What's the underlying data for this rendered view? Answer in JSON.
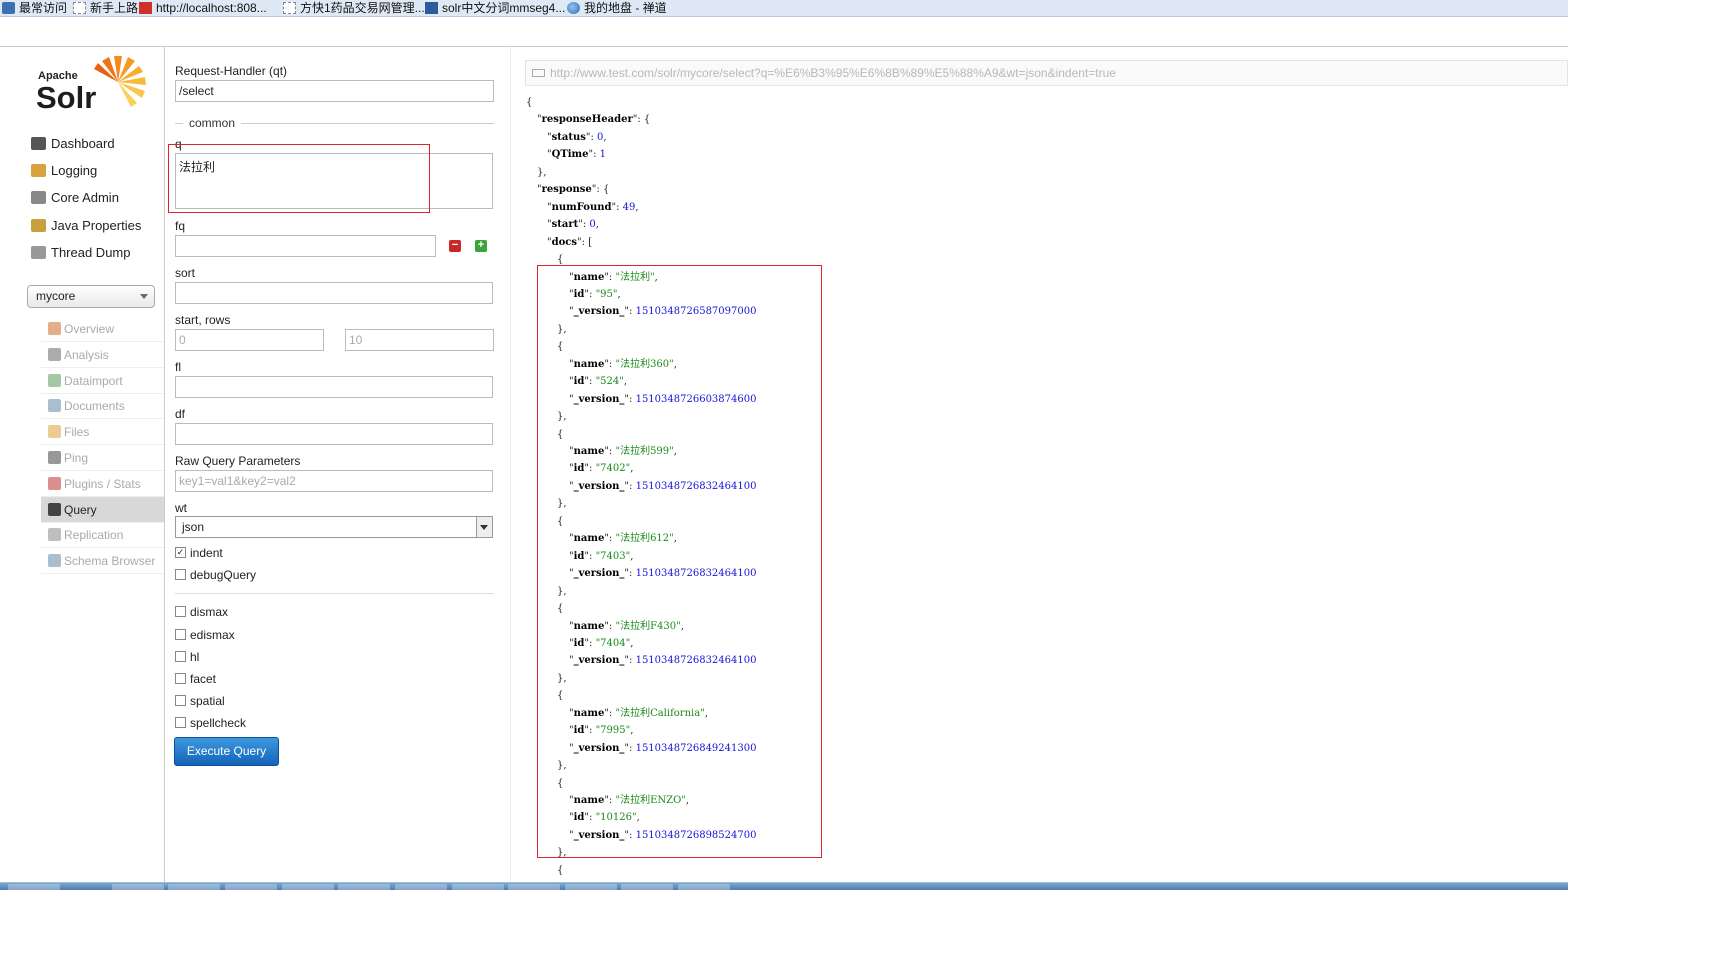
{
  "bookmarks": [
    {
      "label": "最常访问",
      "icon": "bookmark-icon"
    },
    {
      "label": "新手上路",
      "icon": "page-icon"
    },
    {
      "label": "http://localhost:808...",
      "icon": "bookmark-icon"
    },
    {
      "label": "方快1药品交易网管理...",
      "icon": "page-icon"
    },
    {
      "label": "solr中文分词mmseg4...",
      "icon": "note-icon"
    },
    {
      "label": "我的地盘 - 禅道",
      "icon": "globe-icon"
    }
  ],
  "logo": {
    "small": "Apache",
    "big": "Solr"
  },
  "nav": [
    {
      "label": "Dashboard",
      "icon": "dashboard-icon",
      "color": "#555555"
    },
    {
      "label": "Logging",
      "icon": "logging-icon",
      "color": "#d9a23c"
    },
    {
      "label": "Core Admin",
      "icon": "core-admin-icon",
      "color": "#888888"
    },
    {
      "label": "Java Properties",
      "icon": "java-icon",
      "color": "#c8a040"
    },
    {
      "label": "Thread Dump",
      "icon": "thread-icon",
      "color": "#999999"
    }
  ],
  "core_select": {
    "value": "mycore"
  },
  "core_menu": [
    {
      "label": "Overview",
      "icon": "home-icon",
      "color": "#d06a2c"
    },
    {
      "label": "Analysis",
      "icon": "funnel-icon",
      "color": "#666666"
    },
    {
      "label": "Dataimport",
      "icon": "import-icon",
      "color": "#5a9a5a"
    },
    {
      "label": "Documents",
      "icon": "documents-icon",
      "color": "#6688aa"
    },
    {
      "label": "Files",
      "icon": "files-icon",
      "color": "#d9a23c"
    },
    {
      "label": "Ping",
      "icon": "ping-icon",
      "color": "#444444"
    },
    {
      "label": "Plugins / Stats",
      "icon": "plugins-icon",
      "color": "#c03030"
    },
    {
      "label": "Query",
      "icon": "search-icon",
      "color": "#444444"
    },
    {
      "label": "Replication",
      "icon": "replication-icon",
      "color": "#888888"
    },
    {
      "label": "Schema Browser",
      "icon": "schema-icon",
      "color": "#6688aa"
    }
  ],
  "form": {
    "request_handler_label": "Request-Handler (qt)",
    "request_handler_value": "/select",
    "common_label": "common",
    "q_label": "q",
    "q_value": "法拉利",
    "fq_label": "fq",
    "fq_value": "",
    "sort_label": "sort",
    "sort_value": "",
    "start_rows_label": "start, rows",
    "start_placeholder": "0",
    "rows_placeholder": "10",
    "fl_label": "fl",
    "df_label": "df",
    "raw_label": "Raw Query Parameters",
    "raw_placeholder": "key1=val1&key2=val2",
    "wt_label": "wt",
    "wt_value": "json",
    "checkboxes": [
      {
        "label": "indent",
        "checked": true
      },
      {
        "label": "debugQuery",
        "checked": false
      },
      {
        "label": "dismax",
        "checked": false
      },
      {
        "label": "edismax",
        "checked": false
      },
      {
        "label": "hl",
        "checked": false
      },
      {
        "label": "facet",
        "checked": false
      },
      {
        "label": "spatial",
        "checked": false
      },
      {
        "label": "spellcheck",
        "checked": false
      }
    ],
    "execute_label": "Execute Query"
  },
  "result_url": "http://www.test.com/solr/mycore/select?q=%E6%B3%95%E6%8B%89%E5%88%A9&wt=json&indent=true",
  "json_lines": [
    {
      "i": 0,
      "t": [
        [
          "p",
          "{"
        ]
      ]
    },
    {
      "i": 1,
      "t": [
        [
          "p",
          "\""
        ],
        [
          "k",
          "responseHeader"
        ],
        [
          "p",
          "\": {"
        ]
      ]
    },
    {
      "i": 2,
      "t": [
        [
          "p",
          "\""
        ],
        [
          "k",
          "status"
        ],
        [
          "p",
          "\": "
        ],
        [
          "n",
          "0"
        ],
        [
          "p",
          ","
        ]
      ]
    },
    {
      "i": 2,
      "t": [
        [
          "p",
          "\""
        ],
        [
          "k",
          "QTime"
        ],
        [
          "p",
          "\": "
        ],
        [
          "n",
          "1"
        ]
      ]
    },
    {
      "i": 1,
      "t": [
        [
          "p",
          "},"
        ]
      ]
    },
    {
      "i": 1,
      "t": [
        [
          "p",
          "\""
        ],
        [
          "k",
          "response"
        ],
        [
          "p",
          "\": {"
        ]
      ]
    },
    {
      "i": 2,
      "t": [
        [
          "p",
          "\""
        ],
        [
          "k",
          "numFound"
        ],
        [
          "p",
          "\": "
        ],
        [
          "n",
          "49"
        ],
        [
          "p",
          ","
        ]
      ]
    },
    {
      "i": 2,
      "t": [
        [
          "p",
          "\""
        ],
        [
          "k",
          "start"
        ],
        [
          "p",
          "\": "
        ],
        [
          "n",
          "0"
        ],
        [
          "p",
          ","
        ]
      ]
    },
    {
      "i": 2,
      "t": [
        [
          "p",
          "\""
        ],
        [
          "k",
          "docs"
        ],
        [
          "p",
          "\": ["
        ]
      ]
    },
    {
      "i": 3,
      "t": [
        [
          "p",
          "{"
        ]
      ]
    },
    {
      "i": 4,
      "t": [
        [
          "p",
          "\""
        ],
        [
          "k",
          "name"
        ],
        [
          "p",
          "\": "
        ],
        [
          "s",
          "\"法拉利\""
        ],
        [
          "p",
          ","
        ]
      ]
    },
    {
      "i": 4,
      "t": [
        [
          "p",
          "\""
        ],
        [
          "k",
          "id"
        ],
        [
          "p",
          "\": "
        ],
        [
          "s",
          "\"95\""
        ],
        [
          "p",
          ","
        ]
      ]
    },
    {
      "i": 4,
      "t": [
        [
          "p",
          "\""
        ],
        [
          "k",
          "_version_"
        ],
        [
          "p",
          "\": "
        ],
        [
          "n",
          "1510348726587097000"
        ]
      ]
    },
    {
      "i": 3,
      "t": [
        [
          "p",
          "},"
        ]
      ]
    },
    {
      "i": 3,
      "t": [
        [
          "p",
          "{"
        ]
      ]
    },
    {
      "i": 4,
      "t": [
        [
          "p",
          "\""
        ],
        [
          "k",
          "name"
        ],
        [
          "p",
          "\": "
        ],
        [
          "s",
          "\"法拉利360\""
        ],
        [
          "p",
          ","
        ]
      ]
    },
    {
      "i": 4,
      "t": [
        [
          "p",
          "\""
        ],
        [
          "k",
          "id"
        ],
        [
          "p",
          "\": "
        ],
        [
          "s",
          "\"524\""
        ],
        [
          "p",
          ","
        ]
      ]
    },
    {
      "i": 4,
      "t": [
        [
          "p",
          "\""
        ],
        [
          "k",
          "_version_"
        ],
        [
          "p",
          "\": "
        ],
        [
          "n",
          "1510348726603874600"
        ]
      ]
    },
    {
      "i": 3,
      "t": [
        [
          "p",
          "},"
        ]
      ]
    },
    {
      "i": 3,
      "t": [
        [
          "p",
          "{"
        ]
      ]
    },
    {
      "i": 4,
      "t": [
        [
          "p",
          "\""
        ],
        [
          "k",
          "name"
        ],
        [
          "p",
          "\": "
        ],
        [
          "s",
          "\"法拉利599\""
        ],
        [
          "p",
          ","
        ]
      ]
    },
    {
      "i": 4,
      "t": [
        [
          "p",
          "\""
        ],
        [
          "k",
          "id"
        ],
        [
          "p",
          "\": "
        ],
        [
          "s",
          "\"7402\""
        ],
        [
          "p",
          ","
        ]
      ]
    },
    {
      "i": 4,
      "t": [
        [
          "p",
          "\""
        ],
        [
          "k",
          "_version_"
        ],
        [
          "p",
          "\": "
        ],
        [
          "n",
          "1510348726832464100"
        ]
      ]
    },
    {
      "i": 3,
      "t": [
        [
          "p",
          "},"
        ]
      ]
    },
    {
      "i": 3,
      "t": [
        [
          "p",
          "{"
        ]
      ]
    },
    {
      "i": 4,
      "t": [
        [
          "p",
          "\""
        ],
        [
          "k",
          "name"
        ],
        [
          "p",
          "\": "
        ],
        [
          "s",
          "\"法拉利612\""
        ],
        [
          "p",
          ","
        ]
      ]
    },
    {
      "i": 4,
      "t": [
        [
          "p",
          "\""
        ],
        [
          "k",
          "id"
        ],
        [
          "p",
          "\": "
        ],
        [
          "s",
          "\"7403\""
        ],
        [
          "p",
          ","
        ]
      ]
    },
    {
      "i": 4,
      "t": [
        [
          "p",
          "\""
        ],
        [
          "k",
          "_version_"
        ],
        [
          "p",
          "\": "
        ],
        [
          "n",
          "1510348726832464100"
        ]
      ]
    },
    {
      "i": 3,
      "t": [
        [
          "p",
          "},"
        ]
      ]
    },
    {
      "i": 3,
      "t": [
        [
          "p",
          "{"
        ]
      ]
    },
    {
      "i": 4,
      "t": [
        [
          "p",
          "\""
        ],
        [
          "k",
          "name"
        ],
        [
          "p",
          "\": "
        ],
        [
          "s",
          "\"法拉利F430\""
        ],
        [
          "p",
          ","
        ]
      ]
    },
    {
      "i": 4,
      "t": [
        [
          "p",
          "\""
        ],
        [
          "k",
          "id"
        ],
        [
          "p",
          "\": "
        ],
        [
          "s",
          "\"7404\""
        ],
        [
          "p",
          ","
        ]
      ]
    },
    {
      "i": 4,
      "t": [
        [
          "p",
          "\""
        ],
        [
          "k",
          "_version_"
        ],
        [
          "p",
          "\": "
        ],
        [
          "n",
          "1510348726832464100"
        ]
      ]
    },
    {
      "i": 3,
      "t": [
        [
          "p",
          "},"
        ]
      ]
    },
    {
      "i": 3,
      "t": [
        [
          "p",
          "{"
        ]
      ]
    },
    {
      "i": 4,
      "t": [
        [
          "p",
          "\""
        ],
        [
          "k",
          "name"
        ],
        [
          "p",
          "\": "
        ],
        [
          "s",
          "\"法拉利California\""
        ],
        [
          "p",
          ","
        ]
      ]
    },
    {
      "i": 4,
      "t": [
        [
          "p",
          "\""
        ],
        [
          "k",
          "id"
        ],
        [
          "p",
          "\": "
        ],
        [
          "s",
          "\"7995\""
        ],
        [
          "p",
          ","
        ]
      ]
    },
    {
      "i": 4,
      "t": [
        [
          "p",
          "\""
        ],
        [
          "k",
          "_version_"
        ],
        [
          "p",
          "\": "
        ],
        [
          "n",
          "1510348726849241300"
        ]
      ]
    },
    {
      "i": 3,
      "t": [
        [
          "p",
          "},"
        ]
      ]
    },
    {
      "i": 3,
      "t": [
        [
          "p",
          "{"
        ]
      ]
    },
    {
      "i": 4,
      "t": [
        [
          "p",
          "\""
        ],
        [
          "k",
          "name"
        ],
        [
          "p",
          "\": "
        ],
        [
          "s",
          "\"法拉利ENZO\""
        ],
        [
          "p",
          ","
        ]
      ]
    },
    {
      "i": 4,
      "t": [
        [
          "p",
          "\""
        ],
        [
          "k",
          "id"
        ],
        [
          "p",
          "\": "
        ],
        [
          "s",
          "\"10126\""
        ],
        [
          "p",
          ","
        ]
      ]
    },
    {
      "i": 4,
      "t": [
        [
          "p",
          "\""
        ],
        [
          "k",
          "_version_"
        ],
        [
          "p",
          "\": "
        ],
        [
          "n",
          "1510348726898524700"
        ]
      ]
    },
    {
      "i": 3,
      "t": [
        [
          "p",
          "},"
        ]
      ]
    },
    {
      "i": 3,
      "t": [
        [
          "p",
          "{"
        ]
      ]
    }
  ],
  "colors": {
    "highlight": "#e0232a",
    "key": "#000000",
    "number": "#1515d8",
    "string": "#1a8a1a",
    "button": "#1463b8"
  }
}
